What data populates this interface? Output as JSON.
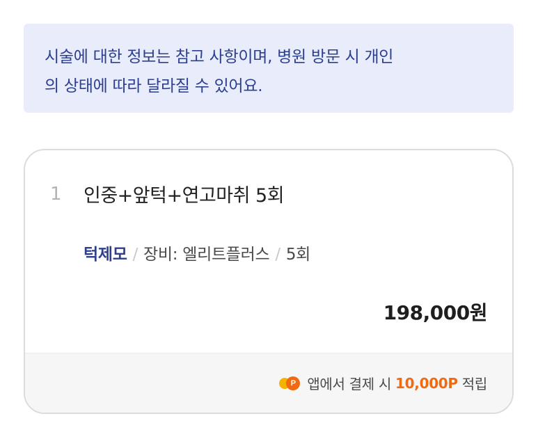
{
  "notice": {
    "line1": "시술에 대한 정보는 참고 사항이며, 병원 방문 시 개인",
    "line2": "의 상태에 따라 달라질 수 있어요."
  },
  "item": {
    "index": "1",
    "title": "인중+앞턱+연고마취 5회",
    "brand": "턱제모",
    "separator": "/",
    "equipment": "장비: 엘리트플러스",
    "count": "5회",
    "price": "198,000원"
  },
  "reward": {
    "coin_icon": "point-coin-icon",
    "coin_letter": "P",
    "prefix": "앱에서 결제 시",
    "amount": "10,000P",
    "suffix": "적립"
  },
  "colors": {
    "notice_bg": "#e9ecfb",
    "notice_text": "#2c3f8f",
    "brand": "#2d3f8e",
    "reward_accent": "#f06a11"
  }
}
